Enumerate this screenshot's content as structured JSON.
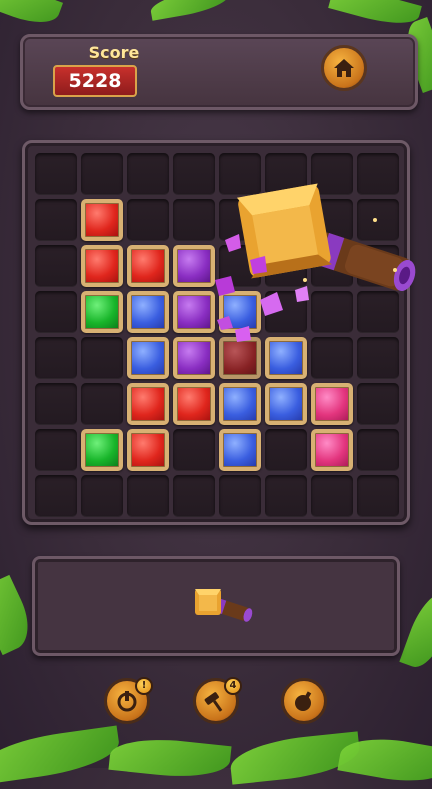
{
  "score": {
    "label": "Score",
    "value": "5228"
  },
  "board": {
    "rows": [
      [
        "",
        "",
        "",
        "",
        "",
        "",
        "",
        ""
      ],
      [
        "",
        "red",
        "",
        "",
        "",
        "",
        "",
        ""
      ],
      [
        "",
        "red",
        "red",
        "purple",
        "",
        "",
        "",
        ""
      ],
      [
        "",
        "green",
        "blue",
        "purple",
        "blue",
        "",
        "",
        ""
      ],
      [
        "",
        "",
        "blue",
        "purple",
        "broken",
        "blue",
        "",
        ""
      ],
      [
        "",
        "",
        "red",
        "red",
        "blue",
        "blue",
        "pink",
        ""
      ],
      [
        "",
        "green",
        "red",
        "",
        "blue",
        "",
        "pink",
        ""
      ],
      [
        "",
        "",
        "",
        "",
        "",
        "",
        "",
        ""
      ]
    ]
  },
  "powerups": [
    {
      "name": "refresh",
      "badge": "!"
    },
    {
      "name": "hammer",
      "badge": "4"
    },
    {
      "name": "bomb",
      "badge": ""
    }
  ],
  "colors": {
    "accent": "#f6b340",
    "score_bg": "#c8302c"
  }
}
